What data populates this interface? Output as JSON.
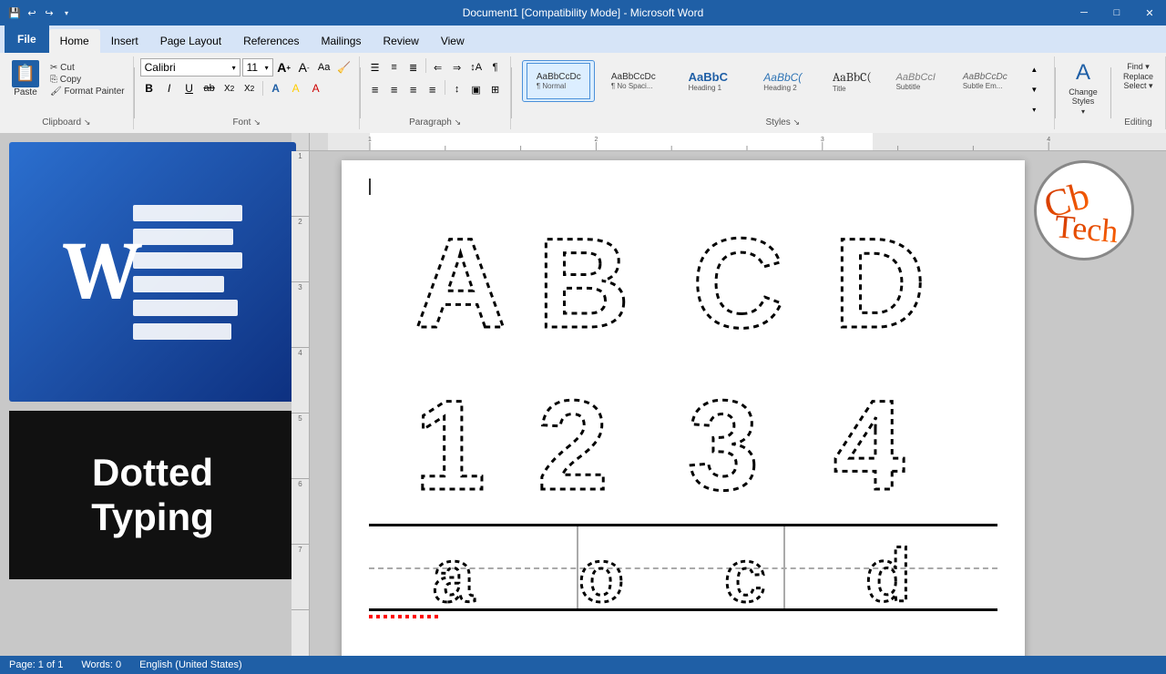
{
  "titlebar": {
    "title": "Document1 [Compatibility Mode] - Microsoft Word",
    "minimize": "─",
    "maximize": "□",
    "close": "✕"
  },
  "quickaccess": {
    "save": "💾",
    "undo": "↩",
    "redo": "↪",
    "customize": "▾"
  },
  "tabs": [
    {
      "label": "File",
      "active": false,
      "file": true
    },
    {
      "label": "Home",
      "active": true,
      "file": false
    },
    {
      "label": "Insert",
      "active": false,
      "file": false
    },
    {
      "label": "Page Layout",
      "active": false,
      "file": false
    },
    {
      "label": "References",
      "active": false,
      "file": false
    },
    {
      "label": "Mailings",
      "active": false,
      "file": false
    },
    {
      "label": "Review",
      "active": false,
      "file": false
    },
    {
      "label": "View",
      "active": false,
      "file": false
    }
  ],
  "clipboard": {
    "label": "Clipboard",
    "paste": "Paste",
    "cut": "✂ Cut",
    "copy": "⎘ Copy",
    "format_painter": "🖌 Format Painter"
  },
  "font": {
    "label": "Font",
    "name": "Calibri",
    "size": "11",
    "grow": "A↑",
    "shrink": "A↓",
    "bold": "B",
    "italic": "I",
    "underline": "U",
    "strikethrough": "ab",
    "subscript": "X₂",
    "superscript": "X²",
    "clear": "A",
    "highlight": "A"
  },
  "paragraph": {
    "label": "Paragraph",
    "bullets": "☰",
    "numbering": "1.",
    "multilevel": "≡",
    "indent_dec": "←",
    "indent_inc": "→",
    "sort": "↕",
    "show_marks": "¶",
    "align_left": "≡",
    "center": "≡",
    "align_right": "≡",
    "justify": "≡",
    "spacing": "↕",
    "shading": "▣",
    "borders": "⊞"
  },
  "styles": {
    "label": "Styles",
    "items": [
      {
        "label": "¶ Normal",
        "sublabel": "Normal",
        "active": true,
        "preview_text": "AaBbCcDc",
        "preview_style": "normal"
      },
      {
        "label": "¶ No Spaci...",
        "sublabel": "No Spaci...",
        "active": false,
        "preview_text": "AaBbCcDc",
        "preview_style": "normal"
      },
      {
        "label": "Heading 1",
        "sublabel": "Heading 1",
        "active": false,
        "preview_text": "AaBbC",
        "preview_style": "heading1"
      },
      {
        "label": "Heading 2",
        "sublabel": "Heading 2",
        "active": false,
        "preview_text": "AaBbC(",
        "preview_style": "heading2"
      },
      {
        "label": "Title",
        "sublabel": "Title",
        "active": false,
        "preview_text": "AaBbC(",
        "preview_style": "title"
      },
      {
        "label": "Subtitle",
        "sublabel": "Subtitle",
        "active": false,
        "preview_text": "AaBbCcI",
        "preview_style": "subtitle"
      },
      {
        "label": "Subtle Em...",
        "sublabel": "Subtle Em...",
        "active": false,
        "preview_text": "AaBbCcDc",
        "preview_style": "subtle"
      }
    ],
    "change_styles": "Change\nStyles"
  },
  "editing": {
    "label": "Editing"
  },
  "document": {
    "letters": [
      "A",
      "B",
      "C",
      "D"
    ],
    "numbers": [
      "1",
      "2",
      "3",
      "4"
    ],
    "lowercase": [
      "a",
      "o",
      "c",
      "d"
    ]
  },
  "logo": {
    "text1": "Cb",
    "text2": "Tech"
  },
  "sidebar": {
    "banner_text": "Dotted\nTyping"
  },
  "statusbar": {
    "page": "Page: 1 of 1",
    "words": "Words: 0",
    "language": "English (United States)"
  }
}
